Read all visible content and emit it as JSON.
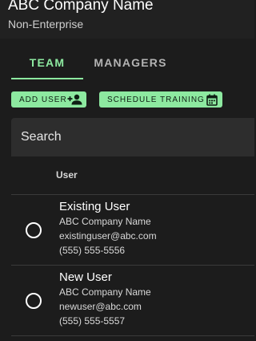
{
  "header": {
    "company_name": "ABC Company Name",
    "company_type": "Non-Enterprise"
  },
  "tabs": [
    {
      "label": "TEAM",
      "active": true
    },
    {
      "label": "MANAGERS",
      "active": false
    }
  ],
  "actions": {
    "add_user": {
      "label": "ADD USER",
      "icon": "add-person-icon"
    },
    "schedule_training": {
      "label": "SCHEDULE TRAINING",
      "icon": "calendar-icon"
    }
  },
  "search": {
    "placeholder": "Search",
    "value": ""
  },
  "table": {
    "column_header": "User",
    "rows": [
      {
        "name": "Existing User",
        "company": "ABC Company Name",
        "email": "existinguser@abc.com",
        "phone": "(555) 555-5556",
        "selected": false
      },
      {
        "name": "New User",
        "company": "ABC Company Name",
        "email": "newuser@abc.com",
        "phone": "(555) 555-5557",
        "selected": false
      }
    ]
  },
  "colors": {
    "accent": "#8de9a0",
    "background": "#1c1c1c",
    "surface": "#2d2d2d",
    "tab_inactive": "#b3b3b3"
  }
}
